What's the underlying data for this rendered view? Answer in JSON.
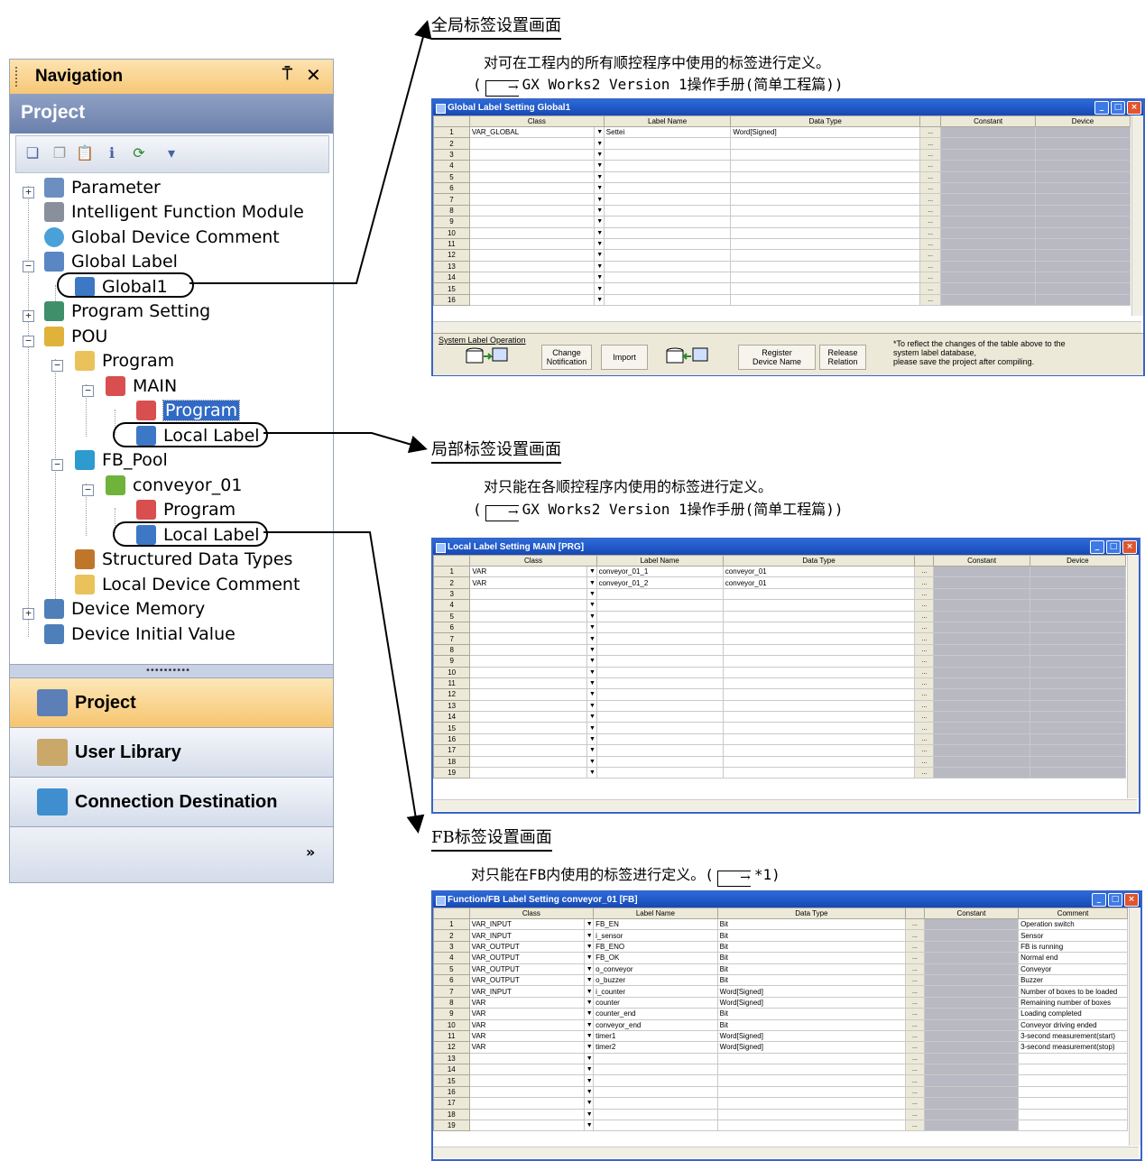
{
  "nav": {
    "title": "Navigation",
    "pin_glyph": "⍑",
    "close_glyph": "✕",
    "section": "Project",
    "tree": [
      {
        "label": "Parameter",
        "icon": "parameter-icon"
      },
      {
        "label": "Intelligent Function Module",
        "icon": "module-icon"
      },
      {
        "label": "Global Device Comment",
        "icon": "comment-icon"
      },
      {
        "label": "Global Label",
        "icon": "label-folder-icon"
      },
      {
        "label": "Global1",
        "icon": "label-icon"
      },
      {
        "label": "Program Setting",
        "icon": "program-setting-icon"
      },
      {
        "label": "POU",
        "icon": "pou-icon"
      },
      {
        "label": "Program",
        "icon": "program-folder-icon"
      },
      {
        "label": "MAIN",
        "icon": "main-icon"
      },
      {
        "label": "Program",
        "icon": "program-icon"
      },
      {
        "label": "Local Label",
        "icon": "label-icon"
      },
      {
        "label": "FB_Pool",
        "icon": "fb-pool-icon"
      },
      {
        "label": "conveyor_01",
        "icon": "fb-icon"
      },
      {
        "label": "Program",
        "icon": "program-icon"
      },
      {
        "label": "Local Label",
        "icon": "label-icon"
      },
      {
        "label": "Structured Data Types",
        "icon": "struct-icon"
      },
      {
        "label": "Local Device Comment",
        "icon": "comment-icon"
      },
      {
        "label": "Device Memory",
        "icon": "memory-icon"
      },
      {
        "label": "Device Initial Value",
        "icon": "init-value-icon"
      }
    ],
    "splitter": "••••••••••",
    "buttons": [
      "Project",
      "User Library",
      "Connection Destination"
    ],
    "more_glyph": "»"
  },
  "global": {
    "heading": "全局标签设置画面",
    "desc1": "对可在工程内的所有顺控程序中使用的标签进行定义。",
    "desc2_pre": "(",
    "desc2_post": "GX Works2 Version 1操作手册(简单工程篇))",
    "window_title": "Global Label Setting Global1",
    "columns": [
      "Class",
      "Label Name",
      "Data Type",
      "Constant",
      "Device"
    ],
    "rows": [
      {
        "n": "1",
        "cls": "VAR_GLOBAL",
        "name": "Settei",
        "type": "Word[Signed]"
      },
      {
        "n": "2"
      },
      {
        "n": "3"
      },
      {
        "n": "4"
      },
      {
        "n": "5"
      },
      {
        "n": "6"
      },
      {
        "n": "7"
      },
      {
        "n": "8"
      },
      {
        "n": "9"
      },
      {
        "n": "10"
      },
      {
        "n": "11"
      },
      {
        "n": "12"
      },
      {
        "n": "13"
      },
      {
        "n": "14"
      },
      {
        "n": "15"
      },
      {
        "n": "16"
      }
    ],
    "op_label": "System Label Operation",
    "btn_change": [
      "Change",
      "Notification"
    ],
    "btn_import": "Import",
    "btn_register": [
      "Register",
      "Device Name"
    ],
    "btn_release": [
      "Release",
      "Relation"
    ],
    "note": [
      "*To reflect the changes of the table above to the",
      "system label database,",
      "please save the project after compiling."
    ]
  },
  "local": {
    "heading": "局部标签设置画面",
    "desc1": "对只能在各顺控程序内使用的标签进行定义。",
    "desc2_pre": "(",
    "desc2_post": "GX Works2 Version 1操作手册(简单工程篇))",
    "window_title": "Local Label Setting MAIN [PRG]",
    "columns": [
      "Class",
      "Label Name",
      "Data Type",
      "Constant",
      "Device"
    ],
    "rows": [
      {
        "n": "1",
        "cls": "VAR",
        "name": "conveyor_01_1",
        "type": "conveyor_01"
      },
      {
        "n": "2",
        "cls": "VAR",
        "name": "conveyor_01_2",
        "type": "conveyor_01"
      },
      {
        "n": "3"
      },
      {
        "n": "4"
      },
      {
        "n": "5"
      },
      {
        "n": "6"
      },
      {
        "n": "7"
      },
      {
        "n": "8"
      },
      {
        "n": "9"
      },
      {
        "n": "10"
      },
      {
        "n": "11"
      },
      {
        "n": "12"
      },
      {
        "n": "13"
      },
      {
        "n": "14"
      },
      {
        "n": "15"
      },
      {
        "n": "16"
      },
      {
        "n": "17"
      },
      {
        "n": "18"
      },
      {
        "n": "19"
      }
    ]
  },
  "fb": {
    "heading": "FB标签设置画面",
    "desc1": "对只能在FB内使用的标签进行定义。(",
    "desc1_post": "*1)",
    "window_title": "Function/FB Label Setting conveyor_01 [FB]",
    "columns": [
      "Class",
      "Label Name",
      "Data Type",
      "Constant",
      "Comment"
    ],
    "rows": [
      {
        "n": "1",
        "cls": "VAR_INPUT",
        "name": "FB_EN",
        "type": "Bit",
        "comment": "Operation switch"
      },
      {
        "n": "2",
        "cls": "VAR_INPUT",
        "name": "i_sensor",
        "type": "Bit",
        "comment": "Sensor"
      },
      {
        "n": "3",
        "cls": "VAR_OUTPUT",
        "name": "FB_ENO",
        "type": "Bit",
        "comment": "FB is running"
      },
      {
        "n": "4",
        "cls": "VAR_OUTPUT",
        "name": "FB_OK",
        "type": "Bit",
        "comment": "Normal end"
      },
      {
        "n": "5",
        "cls": "VAR_OUTPUT",
        "name": "o_conveyor",
        "type": "Bit",
        "comment": "Conveyor"
      },
      {
        "n": "6",
        "cls": "VAR_OUTPUT",
        "name": "o_buzzer",
        "type": "Bit",
        "comment": "Buzzer"
      },
      {
        "n": "7",
        "cls": "VAR_INPUT",
        "name": "i_counter",
        "type": "Word[Signed]",
        "comment": "Number of boxes to be loaded"
      },
      {
        "n": "8",
        "cls": "VAR",
        "name": "counter",
        "type": "Word[Signed]",
        "comment": "Remaining number of boxes"
      },
      {
        "n": "9",
        "cls": "VAR",
        "name": "counter_end",
        "type": "Bit",
        "comment": "Loading completed"
      },
      {
        "n": "10",
        "cls": "VAR",
        "name": "conveyor_end",
        "type": "Bit",
        "comment": "Conveyor driving ended"
      },
      {
        "n": "11",
        "cls": "VAR",
        "name": "timer1",
        "type": "Word[Signed]",
        "comment": "3-second measurement(start)"
      },
      {
        "n": "12",
        "cls": "VAR",
        "name": "timer2",
        "type": "Word[Signed]",
        "comment": "3-second measurement(stop)"
      },
      {
        "n": "13"
      },
      {
        "n": "14"
      },
      {
        "n": "15"
      },
      {
        "n": "16"
      },
      {
        "n": "17"
      },
      {
        "n": "18"
      },
      {
        "n": "19"
      }
    ]
  },
  "ellipsis": "...",
  "dd_glyph": "▼"
}
